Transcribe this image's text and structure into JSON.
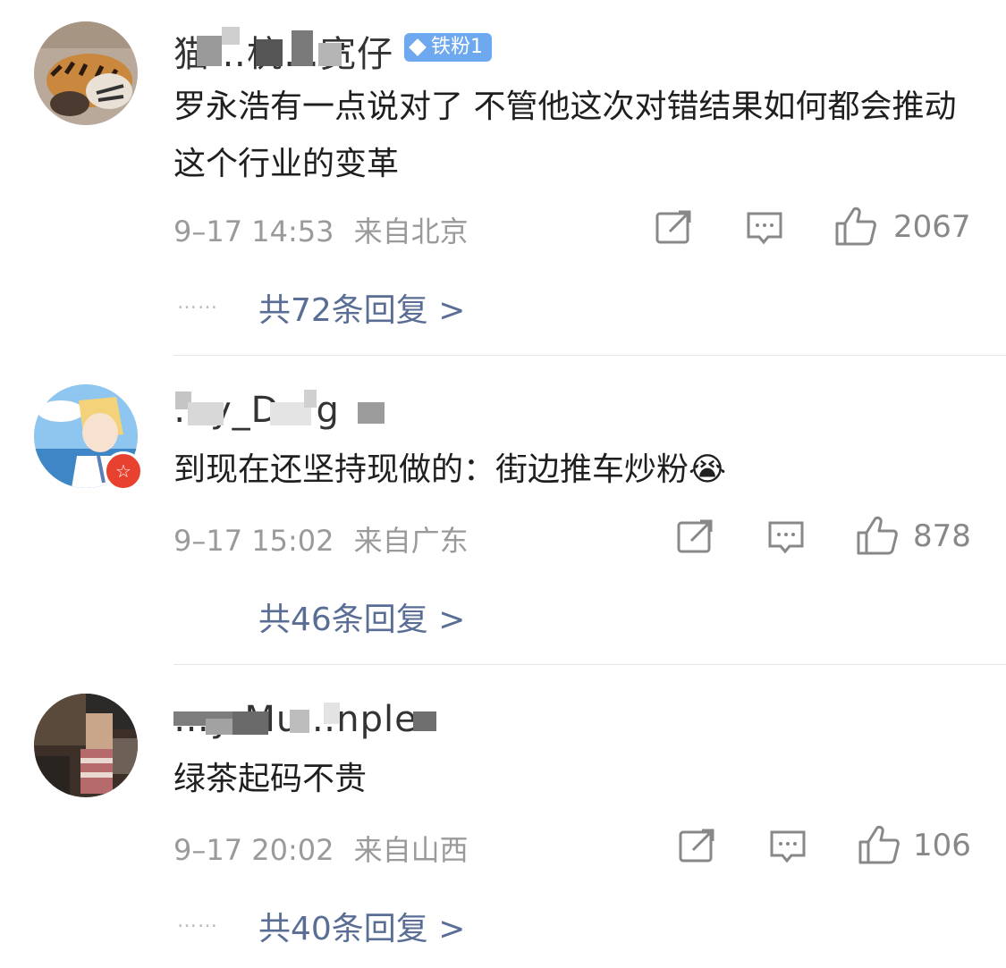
{
  "comments": [
    {
      "username": "猫…杭…宽仔",
      "fan_badge": "铁粉1",
      "text": "罗永浩有一点说对了 不管他这次对错结果如何都会推动这个行业的变革",
      "time": "9–17 14:53",
      "location": "来自北京",
      "likes": "2067",
      "replies_dots": "……",
      "replies": "共72条回复 >"
    },
    {
      "username": "…y_D…g",
      "text": "到现在还坚持现做的：街边推车炒粉😭",
      "time": "9–17 15:02",
      "location": "来自广东",
      "likes": "878",
      "replies": "共46条回复 >"
    },
    {
      "username": "…y Mu…nple",
      "text": "绿茶起码不贵",
      "time": "9–17 20:02",
      "location": "来自山西",
      "likes": "106",
      "replies_dots": "……",
      "replies": "共40条回复 >"
    }
  ],
  "icons": {
    "share": "share-icon",
    "comment": "comment-icon",
    "like": "thumbs-up-icon",
    "verified": "red-verified-badge-icon"
  },
  "colors": {
    "reply_link": "#5a6e95",
    "meta": "#9a9a9a",
    "fan_badge": "#6ea8ef",
    "verified_badge": "#e8412f"
  }
}
